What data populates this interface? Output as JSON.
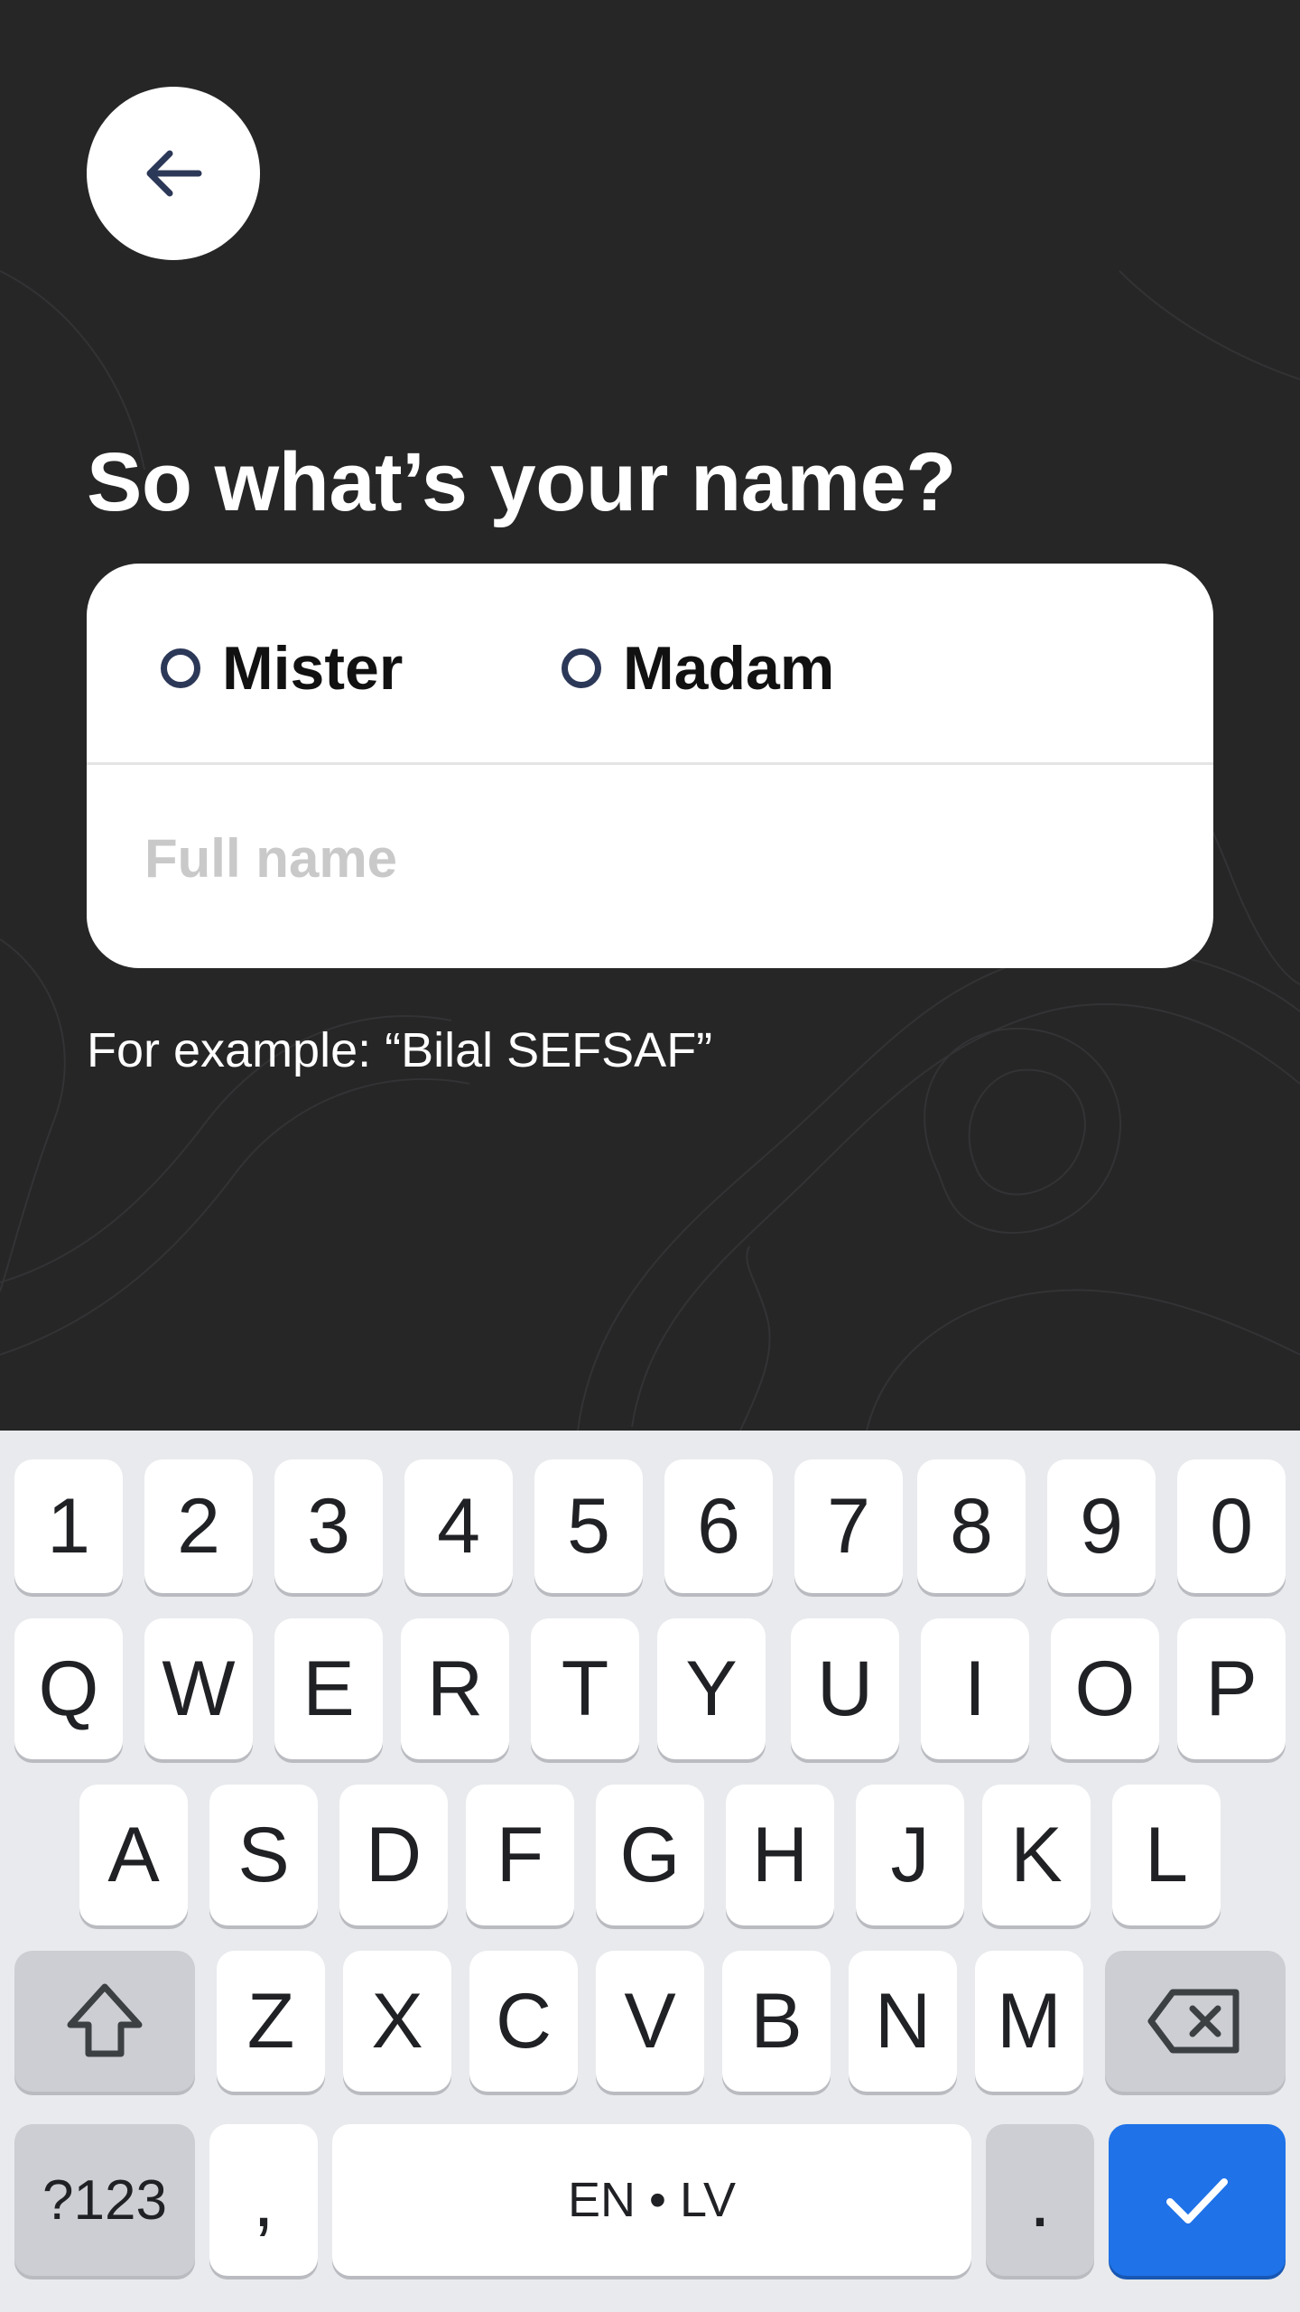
{
  "header": {
    "back_icon": "arrow-left-icon"
  },
  "title": "So what’s your name?",
  "form": {
    "gender_options": [
      {
        "label": "Mister"
      },
      {
        "label": "Madam"
      }
    ],
    "full_name": {
      "value": "",
      "placeholder": "Full name"
    },
    "hint": "For example: “Bilal SEFSAF”"
  },
  "keyboard": {
    "numbers": [
      "1",
      "2",
      "3",
      "4",
      "5",
      "6",
      "7",
      "8",
      "9",
      "0"
    ],
    "row1": [
      "Q",
      "W",
      "E",
      "R",
      "T",
      "Y",
      "U",
      "I",
      "O",
      "P"
    ],
    "row2": [
      "A",
      "S",
      "D",
      "F",
      "G",
      "H",
      "J",
      "K",
      "L"
    ],
    "row3": [
      "Z",
      "X",
      "C",
      "V",
      "B",
      "N",
      "M"
    ],
    "symbols_label": "?123",
    "comma": ",",
    "space_label": "EN • LV",
    "period": ".",
    "shift_icon": "shift-icon",
    "backspace_icon": "backspace-icon",
    "enter_icon": "checkmark-icon"
  },
  "colors": {
    "background": "#262627",
    "card": "#ffffff",
    "radio": "#2c3857",
    "keyboard_bg": "#e8eaed",
    "enter_key": "#1f72e8"
  }
}
